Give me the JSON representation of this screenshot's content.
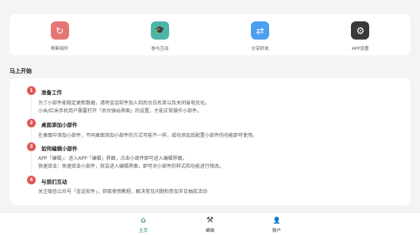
{
  "actions": [
    {
      "label": "刷新组件",
      "icon": "refresh-icon",
      "glyph": "↻",
      "color": "#e67673"
    },
    {
      "label": "参与互动",
      "icon": "graduation-cap-icon",
      "glyph": "🎓",
      "color": "#4db5a5"
    },
    {
      "label": "分享好友",
      "icon": "share-icon",
      "glyph": "⇄",
      "color": "#4a9ff0"
    },
    {
      "label": "APP设置",
      "icon": "settings-icon",
      "glyph": "⚙",
      "color": "#3a3a3a"
    }
  ],
  "section_title": "马上开始",
  "steps": [
    {
      "num": "1",
      "title": "准备工作",
      "lines": [
        "为了小部件能稳定更新数据，请将金话软件加入到后台白名单以及关闭省电优化。",
        "小米/红米手机用户需要打开「后台弹出界面」的设置，才能正常操作小部件。"
      ]
    },
    {
      "num": "2",
      "title": "桌面添加小部件",
      "lines": [
        "在桌面中添加小部件，不同桌面添加小部件的方式可能不一样，成功添加后配置小部件的功能即可使用。"
      ]
    },
    {
      "num": "3",
      "title": "如何编辑小部件",
      "lines": [
        "APP「编辑」：进入APP「编辑」界面，点击小部件即可进入编辑界面。",
        "快速双击：快速双击小部件，就会进入编辑界面，即可对小部件的样式和功能进行修改。"
      ]
    },
    {
      "num": "4",
      "title": "与我们互动",
      "lines": [
        "关注微信公众号「金话软件」，获取使用教程、解决常见问题和参加节日抽奖活动"
      ]
    }
  ],
  "nav": [
    {
      "label": "主页",
      "icon": "home-icon",
      "glyph": "⌂",
      "active": true
    },
    {
      "label": "编辑",
      "icon": "tools-icon",
      "glyph": "⚒",
      "active": false
    },
    {
      "label": "账户",
      "icon": "user-icon",
      "glyph": "👤",
      "active": false
    }
  ],
  "colors": {
    "accent": "#1f7a78",
    "step_badge": "#e2554f"
  }
}
